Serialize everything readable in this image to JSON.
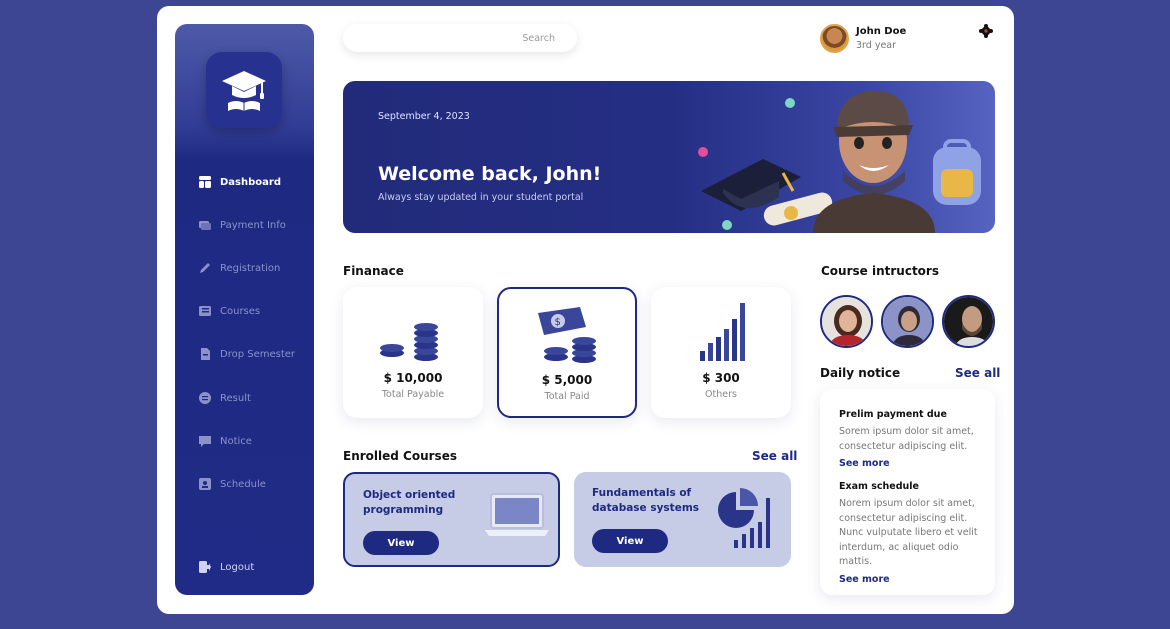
{
  "sidebar": {
    "items": [
      {
        "label": "Dashboard",
        "icon": "dashboard-icon"
      },
      {
        "label": "Payment Info",
        "icon": "payment-icon"
      },
      {
        "label": "Registration",
        "icon": "pencil-icon"
      },
      {
        "label": "Courses",
        "icon": "book-icon"
      },
      {
        "label": "Drop Semester",
        "icon": "file-icon"
      },
      {
        "label": "Result",
        "icon": "result-icon"
      },
      {
        "label": "Notice",
        "icon": "notice-icon"
      },
      {
        "label": "Schedule",
        "icon": "schedule-icon"
      }
    ],
    "logout": "Logout"
  },
  "search": {
    "placeholder": "Search"
  },
  "user": {
    "name": "John Doe",
    "year": "3rd year"
  },
  "banner": {
    "date": "September 4,  2023",
    "title": "Welcome back, John!",
    "subtitle": "Always stay updated in your student portal"
  },
  "finance": {
    "title": "Finanace",
    "cards": [
      {
        "amount": "$ 10,000",
        "label": "Total Payable"
      },
      {
        "amount": "$ 5,000",
        "label": "Total Paid"
      },
      {
        "amount": "$ 300",
        "label": "Others"
      }
    ]
  },
  "courses": {
    "title": "Enrolled Courses",
    "see_all": "See all",
    "items": [
      {
        "title": "Object oriented programming",
        "button": "View"
      },
      {
        "title": "Fundamentals of database systems",
        "button": "View"
      }
    ]
  },
  "instructors": {
    "title": "Course intructors"
  },
  "notice": {
    "title": "Daily notice",
    "see_all": "See all",
    "items": [
      {
        "title": "Prelim payment due",
        "body": "Sorem ipsum dolor sit amet, consectetur adipiscing elit.",
        "more": "See more"
      },
      {
        "title": "Exam schedule",
        "body": "Norem ipsum dolor sit amet, consectetur adipiscing elit. Nunc vulputate libero et velit interdum, ac aliquet odio mattis.",
        "more": "See more"
      }
    ]
  },
  "colors": {
    "brand": "#1e2a82",
    "background": "#3d4693",
    "card_tint": "#c6cbe6"
  }
}
